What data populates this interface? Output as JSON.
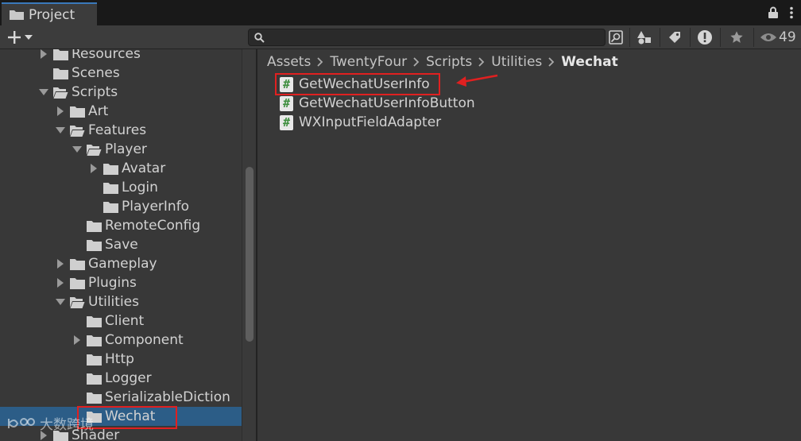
{
  "window": {
    "tab_title": "Project",
    "visible_count": "49"
  },
  "toolbar": {
    "create_label": "+",
    "search_placeholder": ""
  },
  "tree": {
    "items": [
      {
        "label": "Resources",
        "depth": 1,
        "arrow": "right",
        "selected": false
      },
      {
        "label": "Scenes",
        "depth": 1,
        "arrow": "none",
        "selected": false
      },
      {
        "label": "Scripts",
        "depth": 1,
        "arrow": "down",
        "selected": false
      },
      {
        "label": "Art",
        "depth": 2,
        "arrow": "right",
        "selected": false
      },
      {
        "label": "Features",
        "depth": 2,
        "arrow": "down",
        "selected": false
      },
      {
        "label": "Player",
        "depth": 3,
        "arrow": "down",
        "selected": false
      },
      {
        "label": "Avatar",
        "depth": 4,
        "arrow": "right",
        "selected": false
      },
      {
        "label": "Login",
        "depth": 4,
        "arrow": "none",
        "selected": false
      },
      {
        "label": "PlayerInfo",
        "depth": 4,
        "arrow": "none",
        "selected": false
      },
      {
        "label": "RemoteConfig",
        "depth": 3,
        "arrow": "none",
        "selected": false
      },
      {
        "label": "Save",
        "depth": 3,
        "arrow": "none",
        "selected": false
      },
      {
        "label": "Gameplay",
        "depth": 2,
        "arrow": "right",
        "selected": false
      },
      {
        "label": "Plugins",
        "depth": 2,
        "arrow": "right",
        "selected": false
      },
      {
        "label": "Utilities",
        "depth": 2,
        "arrow": "down",
        "selected": false
      },
      {
        "label": "Client",
        "depth": 3,
        "arrow": "none",
        "selected": false
      },
      {
        "label": "Component",
        "depth": 3,
        "arrow": "right",
        "selected": false
      },
      {
        "label": "Http",
        "depth": 3,
        "arrow": "none",
        "selected": false
      },
      {
        "label": "Logger",
        "depth": 3,
        "arrow": "none",
        "selected": false
      },
      {
        "label": "SerializableDiction",
        "depth": 3,
        "arrow": "none",
        "selected": false
      },
      {
        "label": "Wechat",
        "depth": 3,
        "arrow": "none",
        "selected": true
      },
      {
        "label": "Shader",
        "depth": 1,
        "arrow": "right",
        "selected": false
      }
    ]
  },
  "breadcrumb": [
    "Assets",
    "TwentyFour",
    "Scripts",
    "Utilities",
    "Wechat"
  ],
  "files": [
    {
      "name": "GetWechatUserInfo",
      "icon": "csharp-script-icon"
    },
    {
      "name": "GetWechatUserInfoButton",
      "icon": "csharp-script-icon"
    },
    {
      "name": "WXInputFieldAdapter",
      "icon": "csharp-script-icon"
    }
  ],
  "watermark": {
    "text": "大数跨境"
  },
  "colors": {
    "selection": "#2c5d87",
    "annotation": "#e02020",
    "tab_accent": "#3a79bb"
  }
}
